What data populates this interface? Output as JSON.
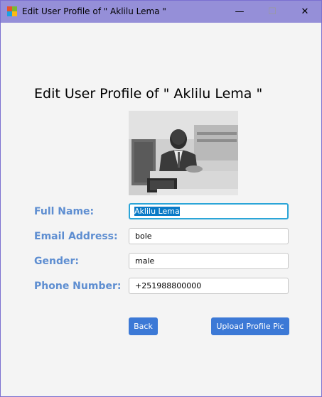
{
  "window": {
    "title": "Edit User Profile of \" Aklilu Lema \"",
    "controls": {
      "minimize": "—",
      "maximize": "☐",
      "close": "✕"
    }
  },
  "heading": "Edit User Profile of \" Aklilu Lema \"",
  "form": {
    "full_name": {
      "label": "Full Name:",
      "value": "Aklilu Lema"
    },
    "email": {
      "label": "Email Address:",
      "value": "bole"
    },
    "gender": {
      "label": "Gender:",
      "value": "male"
    },
    "phone": {
      "label": "Phone Number:",
      "value": "+251988800000"
    }
  },
  "buttons": {
    "back": "Back",
    "upload": "Upload Profile Pic"
  },
  "colors": {
    "titlebar": "#958fd8",
    "label": "#5e8ed1",
    "button": "#3c79d6",
    "focus": "#2ba5d8"
  }
}
